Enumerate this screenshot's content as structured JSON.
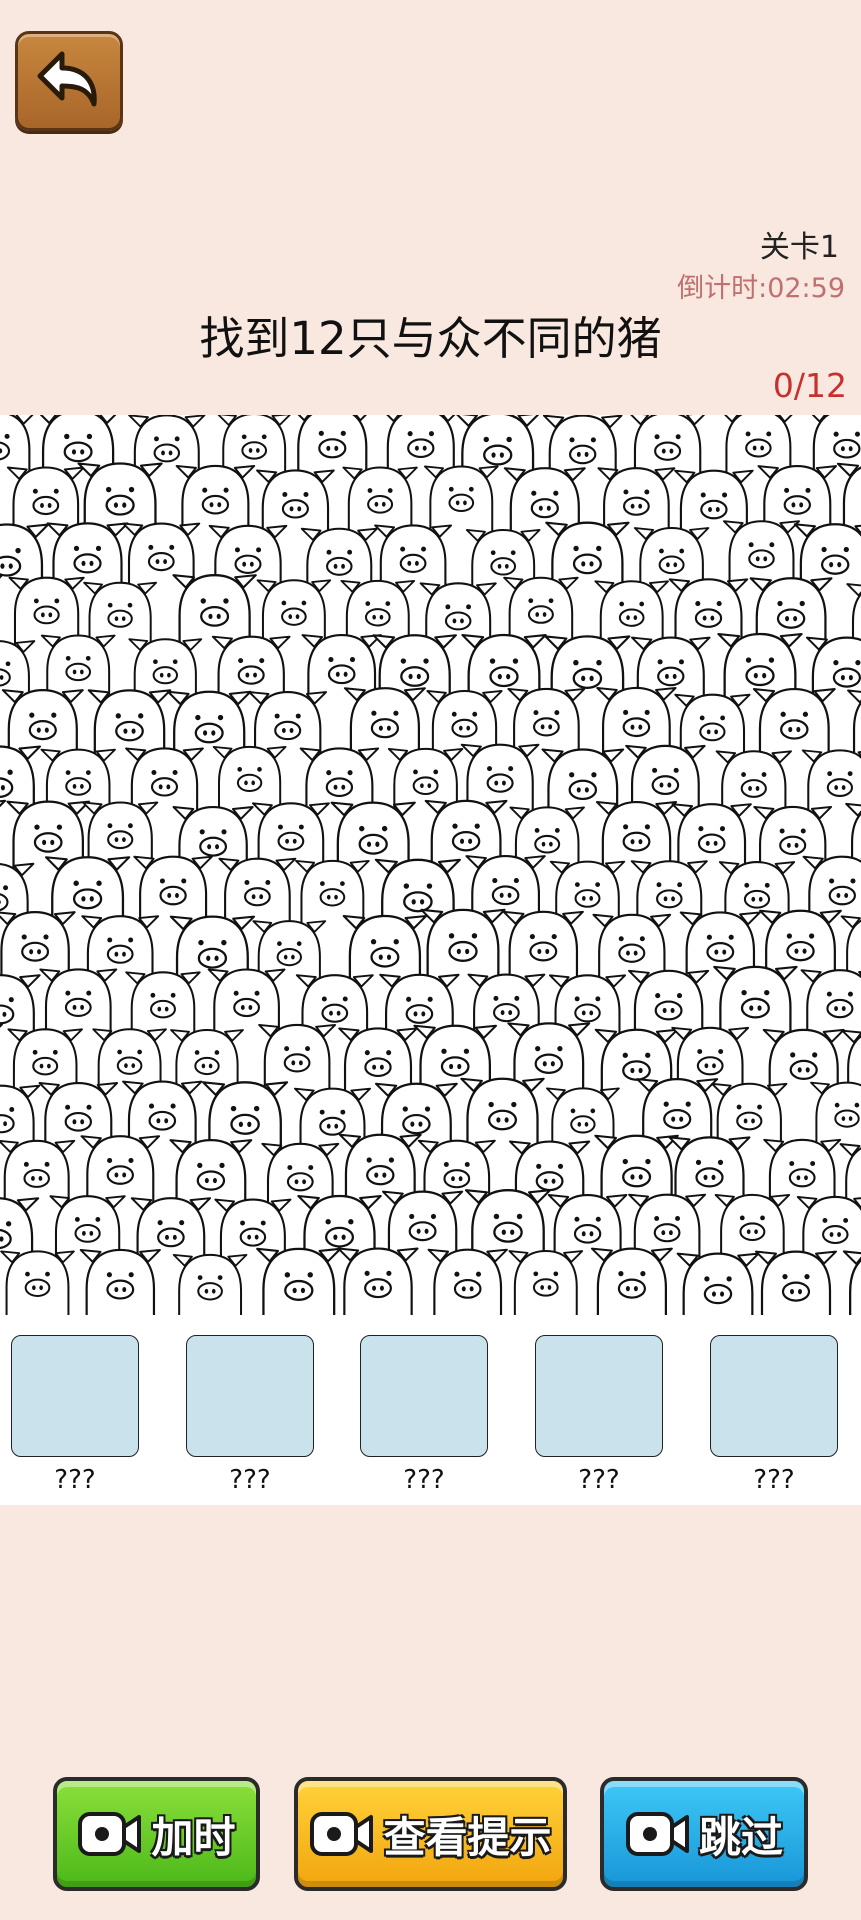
{
  "header": {
    "level": "关卡1",
    "timer": "倒计时:02:59",
    "title": "找到12只与众不同的猪",
    "progress": "0/12"
  },
  "slots": [
    {
      "label": "???"
    },
    {
      "label": "???"
    },
    {
      "label": "???"
    },
    {
      "label": "???"
    },
    {
      "label": "???"
    }
  ],
  "actions": {
    "add_time": "加时",
    "hint": "查看提示",
    "skip": "跳过"
  },
  "icons": {
    "back": "back-arrow-icon",
    "video": "video-camera-icon"
  },
  "colors": {
    "background": "#f8e8e0",
    "slot_fill": "#c9e2ec",
    "timer": "#c07070",
    "progress": "#c83030",
    "add_time_button": "#6ccc2a",
    "hint_button": "#f7bc20",
    "skip_button": "#28aee6"
  }
}
